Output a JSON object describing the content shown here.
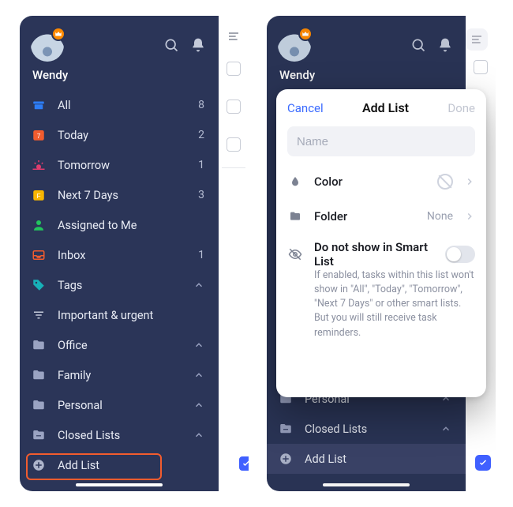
{
  "user": {
    "name": "Wendy"
  },
  "sidebar": {
    "search_icon": "search-icon",
    "bell_icon": "bell-icon",
    "items": [
      {
        "id": "all",
        "label": "All",
        "count": "8",
        "icon": "archive",
        "icon_color": "#2d7df6"
      },
      {
        "id": "today",
        "label": "Today",
        "count": "2",
        "icon": "calendar-7",
        "icon_color": "#f25c2e"
      },
      {
        "id": "tomorrow",
        "label": "Tomorrow",
        "count": "1",
        "icon": "sunrise",
        "icon_color": "#e23d6d"
      },
      {
        "id": "next7",
        "label": "Next 7 Days",
        "count": "3",
        "icon": "calendar-f",
        "icon_color": "#f7b500"
      },
      {
        "id": "assigned",
        "label": "Assigned to Me",
        "count": "",
        "icon": "person",
        "icon_color": "#22c55e"
      },
      {
        "id": "inbox",
        "label": "Inbox",
        "count": "1",
        "icon": "tray",
        "icon_color": "#f25c2e"
      },
      {
        "id": "tags",
        "label": "Tags",
        "count": "",
        "icon": "tag",
        "icon_color": "#17b1b8",
        "chevron": true
      },
      {
        "id": "important",
        "label": "Important & urgent",
        "count": "",
        "icon": "filter",
        "icon_color": "#c4cada"
      },
      {
        "id": "office",
        "label": "Office",
        "count": "",
        "icon": "folder",
        "icon_color": "#9aa3c2",
        "chevron": true
      },
      {
        "id": "family",
        "label": "Family",
        "count": "",
        "icon": "folder",
        "icon_color": "#9aa3c2",
        "chevron": true
      },
      {
        "id": "personal",
        "label": "Personal",
        "count": "",
        "icon": "folder",
        "icon_color": "#9aa3c2",
        "chevron": true
      },
      {
        "id": "closed",
        "label": "Closed Lists",
        "count": "",
        "icon": "folder-x",
        "icon_color": "#9aa3c2",
        "chevron": true
      },
      {
        "id": "add",
        "label": "Add List",
        "count": "",
        "icon": "plus-circle",
        "icon_color": "#c4cada"
      }
    ]
  },
  "right_sidebar_short": {
    "items": [
      {
        "id": "personal",
        "label": "Personal",
        "chevron": true
      },
      {
        "id": "closed",
        "label": "Closed Lists",
        "chevron": true
      },
      {
        "id": "add",
        "label": "Add List"
      }
    ]
  },
  "modal": {
    "cancel": "Cancel",
    "title": "Add List",
    "done": "Done",
    "name_placeholder": "Name",
    "color_label": "Color",
    "folder_label": "Folder",
    "folder_value": "None",
    "hide_label": "Do not show in Smart List",
    "hide_desc": "If enabled, tasks within this list won't show in \"All\", \"Today\", \"Tomorrow\", \"Next 7 Days\" or other smart lists. But you will still receive task reminders."
  }
}
